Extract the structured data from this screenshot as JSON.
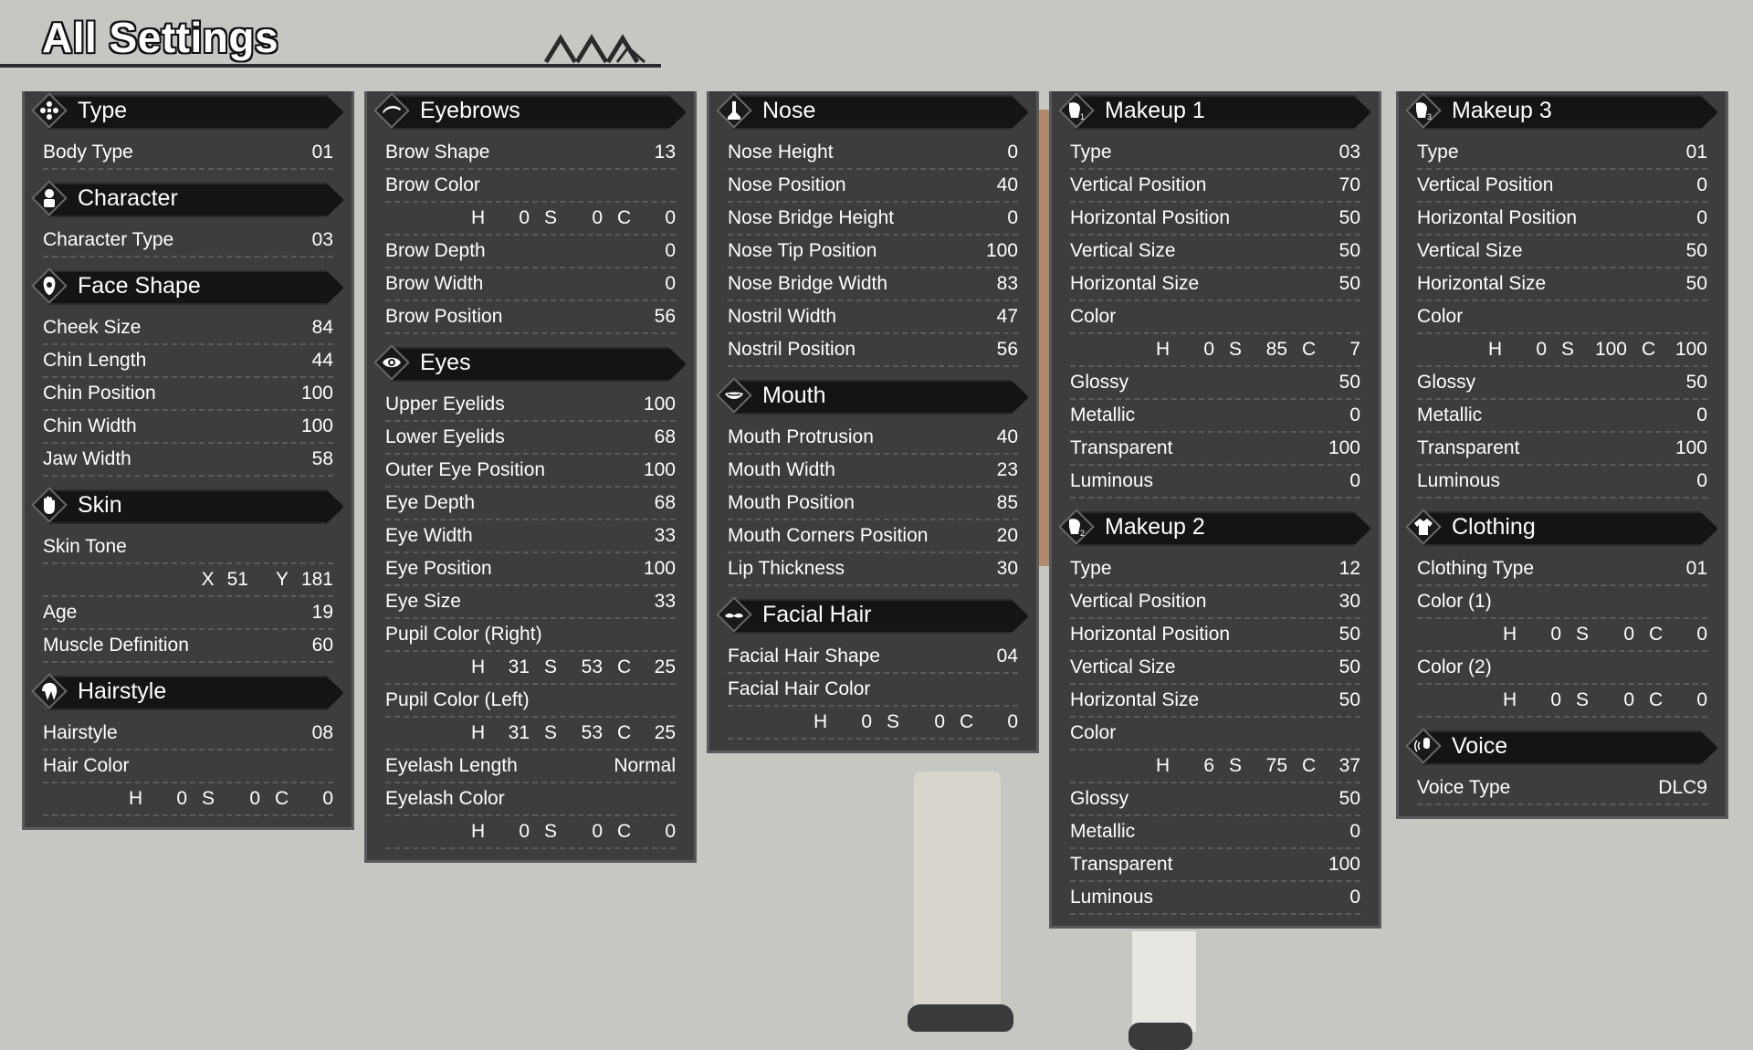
{
  "title": "All Settings",
  "columns": [
    {
      "sections": [
        {
          "icon": "type-icon",
          "label": "Type",
          "rows": [
            {
              "name": "Body Type",
              "value": "01"
            }
          ]
        },
        {
          "icon": "character-icon",
          "label": "Character",
          "rows": [
            {
              "name": "Character Type",
              "value": "03"
            }
          ]
        },
        {
          "icon": "face-shape-icon",
          "label": "Face Shape",
          "rows": [
            {
              "name": "Cheek Size",
              "value": "84"
            },
            {
              "name": "Chin Length",
              "value": "44"
            },
            {
              "name": "Chin Position",
              "value": "100"
            },
            {
              "name": "Chin Width",
              "value": "100"
            },
            {
              "name": "Jaw Width",
              "value": "58"
            }
          ]
        },
        {
          "icon": "hand-icon",
          "label": "Skin",
          "rows": [
            {
              "name": "Skin Tone",
              "value": ""
            },
            {
              "xy": {
                "x": "51",
                "y": "181"
              }
            },
            {
              "name": "Age",
              "value": "19"
            },
            {
              "name": "Muscle Definition",
              "value": "60"
            }
          ]
        },
        {
          "icon": "hairstyle-icon",
          "label": "Hairstyle",
          "rows": [
            {
              "name": "Hairstyle",
              "value": "08"
            },
            {
              "name": "Hair Color",
              "value": ""
            },
            {
              "hsc": {
                "h": "0",
                "s": "0",
                "c": "0"
              }
            }
          ]
        }
      ]
    },
    {
      "sections": [
        {
          "icon": "eyebrow-icon",
          "label": "Eyebrows",
          "rows": [
            {
              "name": "Brow Shape",
              "value": "13"
            },
            {
              "name": "Brow Color",
              "value": ""
            },
            {
              "hsc": {
                "h": "0",
                "s": "0",
                "c": "0"
              }
            },
            {
              "name": "Brow Depth",
              "value": "0"
            },
            {
              "name": "Brow Width",
              "value": "0"
            },
            {
              "name": "Brow Position",
              "value": "56"
            }
          ]
        },
        {
          "icon": "eye-icon",
          "label": "Eyes",
          "rows": [
            {
              "name": "Upper Eyelids",
              "value": "100"
            },
            {
              "name": "Lower Eyelids",
              "value": "68"
            },
            {
              "name": "Outer Eye Position",
              "value": "100"
            },
            {
              "name": "Eye Depth",
              "value": "68"
            },
            {
              "name": "Eye Width",
              "value": "33"
            },
            {
              "name": "Eye Position",
              "value": "100"
            },
            {
              "name": "Eye Size",
              "value": "33"
            },
            {
              "name": "Pupil Color (Right)",
              "value": ""
            },
            {
              "hsc": {
                "h": "31",
                "s": "53",
                "c": "25"
              }
            },
            {
              "name": "Pupil Color (Left)",
              "value": ""
            },
            {
              "hsc": {
                "h": "31",
                "s": "53",
                "c": "25"
              }
            },
            {
              "name": "Eyelash Length",
              "value": "Normal"
            },
            {
              "name": "Eyelash Color",
              "value": ""
            },
            {
              "hsc": {
                "h": "0",
                "s": "0",
                "c": "0"
              }
            }
          ]
        }
      ]
    },
    {
      "sections": [
        {
          "icon": "nose-icon",
          "label": "Nose",
          "rows": [
            {
              "name": "Nose Height",
              "value": "0"
            },
            {
              "name": "Nose Position",
              "value": "40"
            },
            {
              "name": "Nose Bridge Height",
              "value": "0"
            },
            {
              "name": "Nose Tip Position",
              "value": "100"
            },
            {
              "name": "Nose Bridge Width",
              "value": "83"
            },
            {
              "name": "Nostril Width",
              "value": "47"
            },
            {
              "name": "Nostril Position",
              "value": "56"
            }
          ]
        },
        {
          "icon": "mouth-icon",
          "label": "Mouth",
          "rows": [
            {
              "name": "Mouth Protrusion",
              "value": "40"
            },
            {
              "name": "Mouth Width",
              "value": "23"
            },
            {
              "name": "Mouth Position",
              "value": "85"
            },
            {
              "name": "Mouth Corners Position",
              "value": "20"
            },
            {
              "name": "Lip Thickness",
              "value": "30"
            }
          ]
        },
        {
          "icon": "mustache-icon",
          "label": "Facial Hair",
          "rows": [
            {
              "name": "Facial Hair Shape",
              "value": "04"
            },
            {
              "name": "Facial Hair Color",
              "value": ""
            },
            {
              "hsc": {
                "h": "0",
                "s": "0",
                "c": "0"
              }
            }
          ]
        }
      ]
    },
    {
      "sections": [
        {
          "icon": "makeup-1-icon",
          "label": "Makeup 1",
          "rows": [
            {
              "name": "Type",
              "value": "03"
            },
            {
              "name": "Vertical Position",
              "value": "70"
            },
            {
              "name": "Horizontal Position",
              "value": "50"
            },
            {
              "name": "Vertical Size",
              "value": "50"
            },
            {
              "name": "Horizontal Size",
              "value": "50"
            },
            {
              "name": "Color",
              "value": ""
            },
            {
              "hsc": {
                "h": "0",
                "s": "85",
                "c": "7"
              }
            },
            {
              "name": "Glossy",
              "value": "50"
            },
            {
              "name": "Metallic",
              "value": "0"
            },
            {
              "name": "Transparent",
              "value": "100"
            },
            {
              "name": "Luminous",
              "value": "0"
            }
          ]
        },
        {
          "icon": "makeup-2-icon",
          "label": "Makeup 2",
          "rows": [
            {
              "name": "Type",
              "value": "12"
            },
            {
              "name": "Vertical Position",
              "value": "30"
            },
            {
              "name": "Horizontal Position",
              "value": "50"
            },
            {
              "name": "Vertical Size",
              "value": "50"
            },
            {
              "name": "Horizontal Size",
              "value": "50"
            },
            {
              "name": "Color",
              "value": ""
            },
            {
              "hsc": {
                "h": "6",
                "s": "75",
                "c": "37"
              }
            },
            {
              "name": "Glossy",
              "value": "50"
            },
            {
              "name": "Metallic",
              "value": "0"
            },
            {
              "name": "Transparent",
              "value": "100"
            },
            {
              "name": "Luminous",
              "value": "0"
            }
          ]
        }
      ]
    },
    {
      "sections": [
        {
          "icon": "makeup-3-icon",
          "label": "Makeup 3",
          "rows": [
            {
              "name": "Type",
              "value": "01"
            },
            {
              "name": "Vertical Position",
              "value": "0"
            },
            {
              "name": "Horizontal Position",
              "value": "0"
            },
            {
              "name": "Vertical Size",
              "value": "50"
            },
            {
              "name": "Horizontal Size",
              "value": "50"
            },
            {
              "name": "Color",
              "value": ""
            },
            {
              "hsc": {
                "h": "0",
                "s": "100",
                "c": "100"
              }
            },
            {
              "name": "Glossy",
              "value": "50"
            },
            {
              "name": "Metallic",
              "value": "0"
            },
            {
              "name": "Transparent",
              "value": "100"
            },
            {
              "name": "Luminous",
              "value": "0"
            }
          ]
        },
        {
          "icon": "clothing-icon",
          "label": "Clothing",
          "rows": [
            {
              "name": "Clothing Type",
              "value": "01"
            },
            {
              "name": "Color (1)",
              "value": ""
            },
            {
              "hsc": {
                "h": "0",
                "s": "0",
                "c": "0"
              }
            },
            {
              "name": "Color (2)",
              "value": ""
            },
            {
              "hsc": {
                "h": "0",
                "s": "0",
                "c": "0"
              }
            }
          ]
        },
        {
          "icon": "voice-icon",
          "label": "Voice",
          "rows": [
            {
              "name": "Voice Type",
              "value": "DLC9"
            }
          ]
        }
      ]
    }
  ],
  "labels": {
    "h": "H",
    "s": "S",
    "c": "C",
    "x": "X",
    "y": "Y"
  },
  "colors": {
    "background": "#c6c7c2",
    "panel": "#3d3d3d",
    "header": "#141414",
    "text": "#ffffff"
  }
}
